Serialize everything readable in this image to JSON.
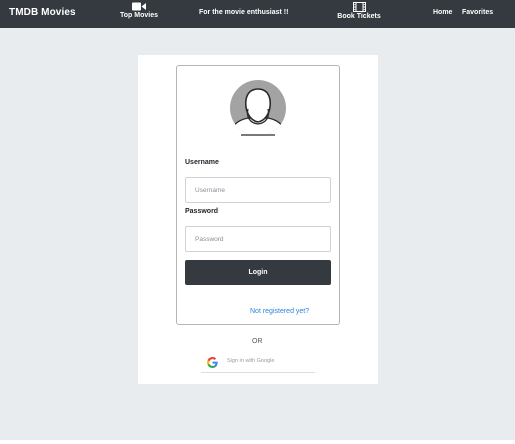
{
  "navbar": {
    "brand": "TMDB Movies",
    "top_movies": {
      "label": "Top Movies",
      "icon": "video-camera-icon"
    },
    "tagline": "For the movie enthusiast !!",
    "book_tickets": {
      "label": "Book Tickets",
      "icon": "film-icon"
    },
    "home": "Home",
    "favorites": "Favorites"
  },
  "login_card": {
    "avatar_icon": "user-avatar-icon",
    "username_label": "Username",
    "username_placeholder": "Username",
    "username_value": "",
    "password_label": "Password",
    "password_placeholder": "Password",
    "password_value": "",
    "login_button": "Login",
    "register_link": "Not registered yet?"
  },
  "alternate_login": {
    "or_text": "OR",
    "google_button": "Sign in with Google",
    "google_icon": "google-g-icon"
  },
  "colors": {
    "navbar_bg": "#343a40",
    "page_bg": "#e9ecef",
    "button_bg": "#343a40",
    "link": "#2e84d8"
  }
}
